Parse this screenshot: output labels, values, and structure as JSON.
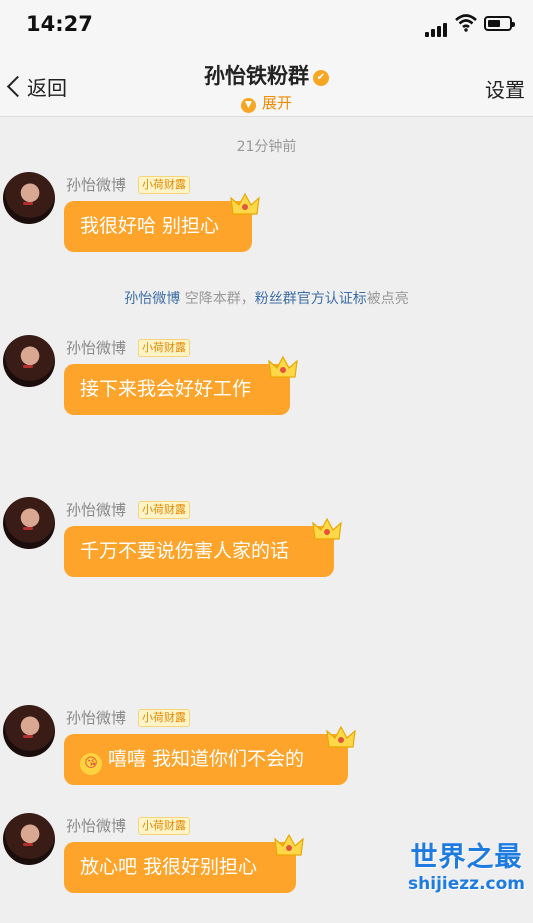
{
  "status": {
    "time": "14:27"
  },
  "nav": {
    "back_label": "返回",
    "title": "孙怡铁粉群",
    "expand_label": "展开",
    "settings_label": "设置"
  },
  "timestamp": "21分钟前",
  "notice": {
    "name": "孙怡微博",
    "text1": "空降本群，",
    "highlight": "粉丝群官方认证标",
    "text2": "被点亮"
  },
  "messages": [
    {
      "sender": "孙怡微博",
      "badge": "小荷财露",
      "text": "我很好哈 别担心"
    },
    {
      "sender": "孙怡微博",
      "badge": "小荷财露",
      "text": "接下来我会好好工作"
    },
    {
      "sender": "孙怡微博",
      "badge": "小荷财露",
      "text": "千万不要说伤害人家的话"
    },
    {
      "sender": "孙怡微博",
      "badge": "小荷财露",
      "emoji": "😘",
      "text": "嘻嘻 我知道你们不会的"
    },
    {
      "sender": "孙怡微博",
      "badge": "小荷财露",
      "text": "放心吧 我很好别担心"
    }
  ],
  "watermark": {
    "title": "世界之最",
    "url": "shijiezz.com"
  },
  "colors": {
    "accent": "#ffa42a",
    "link": "#3d6ea5",
    "watermark": "#1e7be0"
  },
  "icons": [
    "back-chevron-icon",
    "verified-badge-icon",
    "crown-icon",
    "signal-icon",
    "wifi-icon",
    "battery-icon"
  ]
}
